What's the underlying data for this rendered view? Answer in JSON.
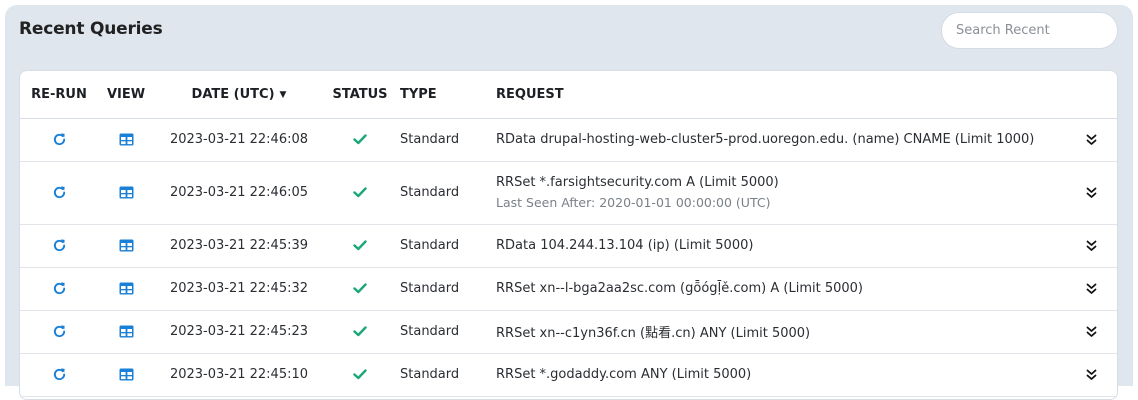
{
  "panel": {
    "title": "Recent Queries"
  },
  "search": {
    "placeholder": "Search Recent"
  },
  "columns": {
    "rerun": "RE-RUN",
    "view": "VIEW",
    "date": "DATE (UTC)",
    "status": "STATUS",
    "type": "TYPE",
    "request": "REQUEST"
  },
  "colors": {
    "accent": "#1a7fd6",
    "success": "#1aa779"
  },
  "icons": {
    "rerun": "refresh-icon",
    "view": "table-view-icon",
    "status": "checkmark-icon",
    "expand": "double-chevron-down-icon",
    "sort": "caret-down-icon"
  },
  "rows": [
    {
      "date": "2023-03-21 22:46:08",
      "type": "Standard",
      "request": "RData drupal-hosting-web-cluster5-prod.uoregon.edu. (name) CNAME (Limit 1000)",
      "sub": ""
    },
    {
      "date": "2023-03-21 22:46:05",
      "type": "Standard",
      "request": "RRSet *.farsightsecurity.com A (Limit 5000)",
      "sub": "Last Seen After: 2020-01-01 00:00:00 (UTC)"
    },
    {
      "date": "2023-03-21 22:45:39",
      "type": "Standard",
      "request": "RData 104.244.13.104 (ip) (Limit 5000)",
      "sub": ""
    },
    {
      "date": "2023-03-21 22:45:32",
      "type": "Standard",
      "request": "RRSet xn--l-bga2aa2sc.com (gȭógḹě.com) A (Limit 5000)",
      "sub": ""
    },
    {
      "date": "2023-03-21 22:45:23",
      "type": "Standard",
      "request": "RRSet xn--c1yn36f.cn (點看.cn) ANY (Limit 5000)",
      "sub": ""
    },
    {
      "date": "2023-03-21 22:45:10",
      "type": "Standard",
      "request": "RRSet *.godaddy.com ANY (Limit 5000)",
      "sub": ""
    }
  ]
}
